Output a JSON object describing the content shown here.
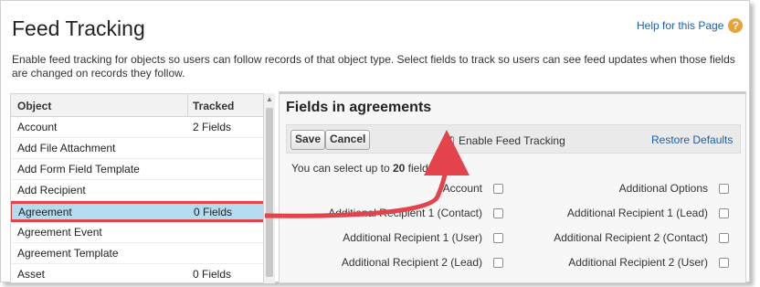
{
  "header": {
    "title": "Feed Tracking",
    "help_label": "Help for this Page",
    "help_icon": "question-icon",
    "description": "Enable feed tracking for objects so users can follow records of that object type. Select fields to track so users can see feed updates when those fields are changed on records they follow."
  },
  "objects": {
    "columns": [
      "Object",
      "Tracked"
    ],
    "rows": [
      {
        "object": "Account",
        "tracked": "2 Fields"
      },
      {
        "object": "Add File Attachment",
        "tracked": ""
      },
      {
        "object": "Add Form Field Template",
        "tracked": ""
      },
      {
        "object": "Add Recipient",
        "tracked": ""
      },
      {
        "object": "Agreement",
        "tracked": "0 Fields",
        "selected": true
      },
      {
        "object": "Agreement Event",
        "tracked": ""
      },
      {
        "object": "Agreement Template",
        "tracked": ""
      },
      {
        "object": "Asset",
        "tracked": "0 Fields"
      }
    ]
  },
  "fields_panel": {
    "title": "Fields in agreements",
    "save_label": "Save",
    "cancel_label": "Cancel",
    "enable_label": "Enable Feed Tracking",
    "enable_checked": true,
    "restore_label": "Restore Defaults",
    "count_prefix": "You can select up to ",
    "count_value": "20",
    "count_suffix": " fields.",
    "left_fields": [
      "Account",
      "Additional Recipient 1 (Contact)",
      "Additional Recipient 1 (User)",
      "Additional Recipient 2 (Lead)"
    ],
    "right_fields": [
      "Additional Options",
      "Additional Recipient 1 (Lead)",
      "Additional Recipient 2 (Contact)",
      "Additional Recipient 2 (User)"
    ]
  },
  "colors": {
    "link": "#1a5fa8",
    "highlight_row": "#b5dbef",
    "annotation": "#e3434b"
  }
}
